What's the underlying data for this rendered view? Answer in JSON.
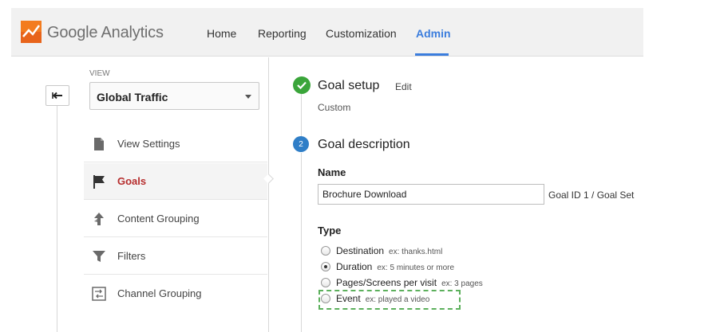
{
  "app": {
    "brand": "Google Analytics"
  },
  "nav": {
    "home": "Home",
    "reporting": "Reporting",
    "customization": "Customization",
    "admin": "Admin"
  },
  "sidebar": {
    "view_label": "VIEW",
    "view_value": "Global Traffic",
    "items": [
      {
        "label": "View Settings",
        "icon": "document-icon"
      },
      {
        "label": "Goals",
        "icon": "flag-icon"
      },
      {
        "label": "Content Grouping",
        "icon": "content-grouping-icon"
      },
      {
        "label": "Filters",
        "icon": "filter-icon"
      },
      {
        "label": "Channel Grouping",
        "icon": "channel-grouping-icon"
      }
    ]
  },
  "goal": {
    "step1_title": "Goal setup",
    "step1_edit": "Edit",
    "step1_value": "Custom",
    "step2_num": "2",
    "step2_title": "Goal description",
    "name_label": "Name",
    "name_value": "Brochure Download",
    "goal_id": "Goal ID 1 / Goal Set",
    "type_label": "Type",
    "types": [
      {
        "label": "Destination",
        "example": "ex: thanks.html",
        "selected": false
      },
      {
        "label": "Duration",
        "example": "ex: 5 minutes or more",
        "selected": true
      },
      {
        "label": "Pages/Screens per visit",
        "example": "ex: 3 pages",
        "selected": false
      },
      {
        "label": "Event",
        "example": "ex: played a video",
        "selected": false
      }
    ]
  },
  "colors": {
    "accent": "#3b7ddd",
    "active_menu": "#b62d2d",
    "check_green": "#3aa53a",
    "step_blue": "#2f7ec7",
    "highlight_dash": "#5cb05c"
  }
}
